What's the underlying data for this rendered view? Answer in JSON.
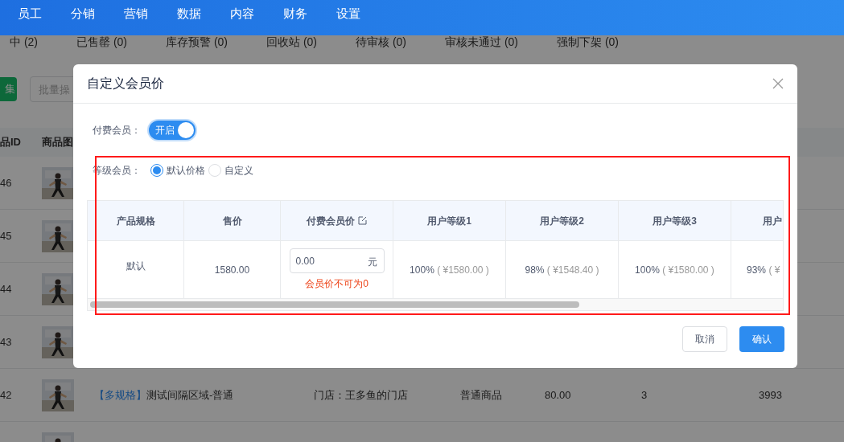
{
  "nav": {
    "items": [
      "员工",
      "分销",
      "营销",
      "数据",
      "内容",
      "财务",
      "设置"
    ]
  },
  "status_tabs": [
    "中 (2)",
    "已售罄 (0)",
    "库存预警 (0)",
    "回收站 (0)",
    "待审核 (0)",
    "审核未通过 (0)",
    "强制下架 (0)"
  ],
  "toolbar": {
    "button": "集",
    "batch_placeholder": "批量操"
  },
  "product_table": {
    "columns": [
      "品ID",
      "商品图"
    ],
    "rows": [
      {
        "id": "46"
      },
      {
        "id": "45"
      },
      {
        "id": "44"
      },
      {
        "id": "43"
      },
      {
        "id": "42",
        "tag": "【多规格】",
        "name": "测试间隔区域-普通",
        "store": "门店：王多鱼的门店",
        "type": "普通商品",
        "price": "80.00",
        "stock": "3",
        "sales": "3993"
      },
      {}
    ]
  },
  "dialog": {
    "title": "自定义会员价",
    "paid_member": {
      "label": "付费会员：",
      "on": true,
      "text": "开启"
    },
    "level_member": {
      "label": "等级会员：",
      "options": [
        {
          "label": "默认价格",
          "selected": true
        },
        {
          "label": "自定义",
          "selected": false
        }
      ]
    },
    "table": {
      "columns": [
        "产品规格",
        "售价",
        "付费会员价",
        "用户等级1",
        "用户等级2",
        "用户等级3",
        "用户"
      ],
      "rows": [
        {
          "spec": "默认",
          "price": "1580.00",
          "member_price": "0.00",
          "unit": "元",
          "error": "会员价不可为0",
          "levels": [
            {
              "percent": "100%",
              "amount": "( ¥1580.00 )"
            },
            {
              "percent": "98%",
              "amount": "( ¥1548.40 )"
            },
            {
              "percent": "100%",
              "amount": "( ¥1580.00 )"
            },
            {
              "percent": "93%",
              "amount": "( ¥"
            }
          ]
        }
      ]
    },
    "buttons": [
      "取消",
      "确认"
    ]
  }
}
